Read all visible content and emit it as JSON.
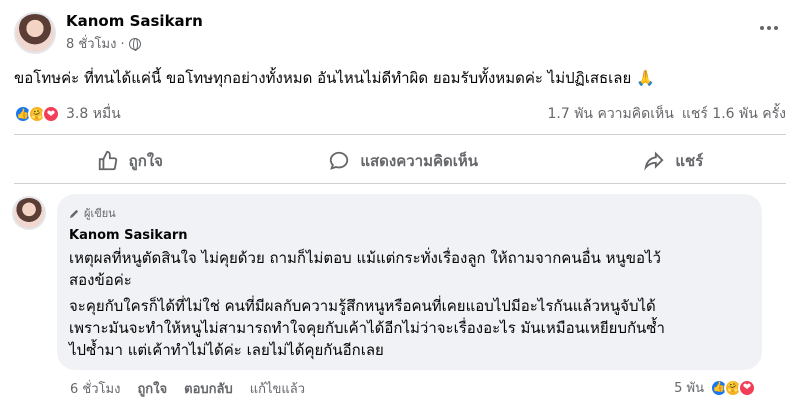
{
  "post": {
    "author": "Kanom Sasikarn",
    "time": "8 ชั่วโมง ·",
    "text": "ขอโทษค่ะ ที่ทนได้แค่นี้ ขอโทษทุกอย่างทั้งหมด อันไหนไม่ดีทำผิด ยอมรับทั้งหมดค่ะ ไม่ปฏิเสธเลย 🙏",
    "reaction_count": "3.8 หมื่น",
    "comments_count": "1.7 พัน ความคิดเห็น",
    "shares_count": "แชร์ 1.6 พัน ครั้ง"
  },
  "actions": {
    "like": "ถูกใจ",
    "comment": "แสดงความคิดเห็น",
    "share": "แชร์"
  },
  "comment": {
    "badge": "ผู้เขียน",
    "author": "Kanom Sasikarn",
    "lines": [
      "เหตุผลที่หนูตัดสินใจ ไม่คุยด้วย ถามก็ไม่ตอบ แม้แต่กระทั่งเรื่องลูก ให้ถามจากคนอื่น หนูขอไว้",
      "สองข้อค่ะ",
      "จะคุยกับใครก็ได้ที่ไม่ใช่ คนที่มีผลกับความรู้สึกหนูหรือคนที่เคยแอบไปมีอะไรกันแล้วหนูจับได้",
      "เพราะมันจะทำให้หนูไม่สามารถทำใจคุยกับเค้าได้อีกไม่ว่าจะเรื่องอะไร มันเหมือนเหยียบกันซ้ำ",
      "ไปซ้ำมา แต่เค้าทำไม่ได้ค่ะ เลยไม่ได้คุยกันอีกเลย"
    ],
    "time": "6 ชั่วโมง",
    "like": "ถูกใจ",
    "reply": "ตอบกลับ",
    "edited": "แก้ไขแล้ว",
    "reaction_count": "5 พัน"
  },
  "colors": {
    "like_blue": "#1877f2",
    "care_yellow": "#f7b125",
    "love_red": "#f33e58",
    "bubble_bg": "#f0f2f5"
  }
}
